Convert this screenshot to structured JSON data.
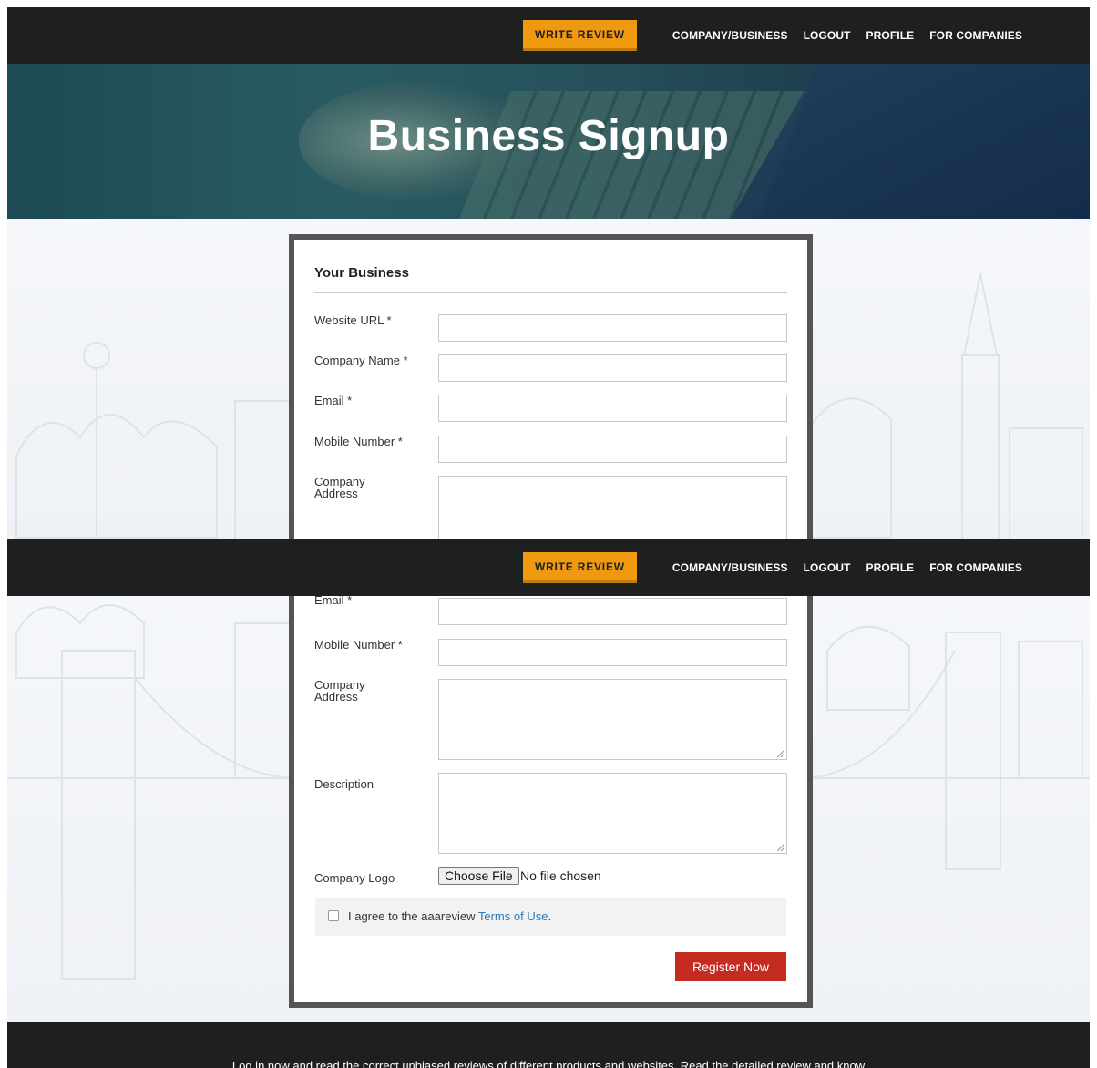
{
  "nav": {
    "write_review": "WRITE REVIEW",
    "links": [
      "COMPANY/BUSINESS",
      "LOGOUT",
      "PROFILE",
      "FOR COMPANIES"
    ]
  },
  "hero": {
    "title": "Business Signup"
  },
  "form": {
    "section_title": "Your Business",
    "website_url_label": "Website URL *",
    "company_name_label": "Company Name *",
    "email_label": "Email *",
    "mobile_label": "Mobile Number *",
    "address_label": "Company Address",
    "description_label": "Description",
    "logo_label": "Company Logo",
    "choose_file": "Choose File",
    "no_file": "No file chosen",
    "terms_prefix": "I agree to the aaareview ",
    "terms_link": "Terms of Use",
    "terms_suffix": ".",
    "register": "Register Now"
  },
  "footer": {
    "text": "Log in now and read the correct unbiased reviews of different products and websites. Read the detailed review and know"
  },
  "colors": {
    "accent": "#ef9910",
    "nav_bg": "#1e1f1f",
    "register": "#c62b22",
    "link": "#2a7ab8"
  }
}
